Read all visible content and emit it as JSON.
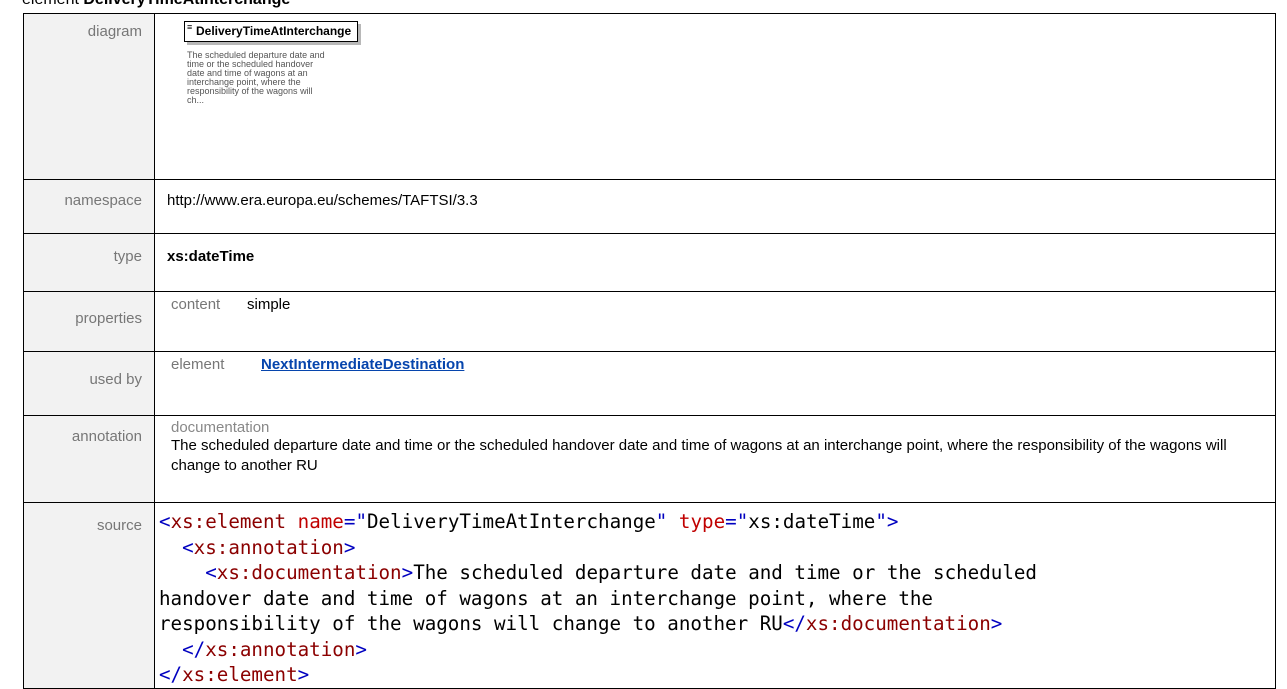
{
  "page": {
    "title_prefix": "element",
    "title_name": "DeliveryTimeAtInterchange"
  },
  "labels": {
    "diagram": "diagram",
    "namespace": "namespace",
    "type": "type",
    "properties": "properties",
    "used_by": "used by",
    "annotation": "annotation",
    "source": "source"
  },
  "diagram": {
    "element_name": "DeliveryTimeAtInterchange",
    "doc_snippet": "The scheduled departure date and time or the scheduled handover date and time of wagons at an interchange point, where the responsibility of the wagons will ch..."
  },
  "namespace": "http://www.era.europa.eu/schemes/TAFTSI/3.3",
  "type": "xs:dateTime",
  "properties": {
    "key": "content",
    "value": "simple"
  },
  "used_by": {
    "kind": "element",
    "link": "NextIntermediateDestination"
  },
  "annotation": {
    "heading": "documentation",
    "text": "The scheduled departure date and time or the scheduled handover date and time of wagons at an interchange point, where the responsibility of the wagons will change to another RU"
  },
  "source": {
    "element_open": "xs:element",
    "attr_name": "name",
    "attr_name_value": "DeliveryTimeAtInterchange",
    "attr_type": "type",
    "attr_type_value": "xs:dateTime",
    "annotation_tag": "xs:annotation",
    "documentation_tag": "xs:documentation",
    "doc_line1": "The scheduled departure date and time or the scheduled",
    "doc_line2": "handover date and time of wagons at an interchange point, where the",
    "doc_line3": "responsibility of the wagons will change to another RU"
  }
}
